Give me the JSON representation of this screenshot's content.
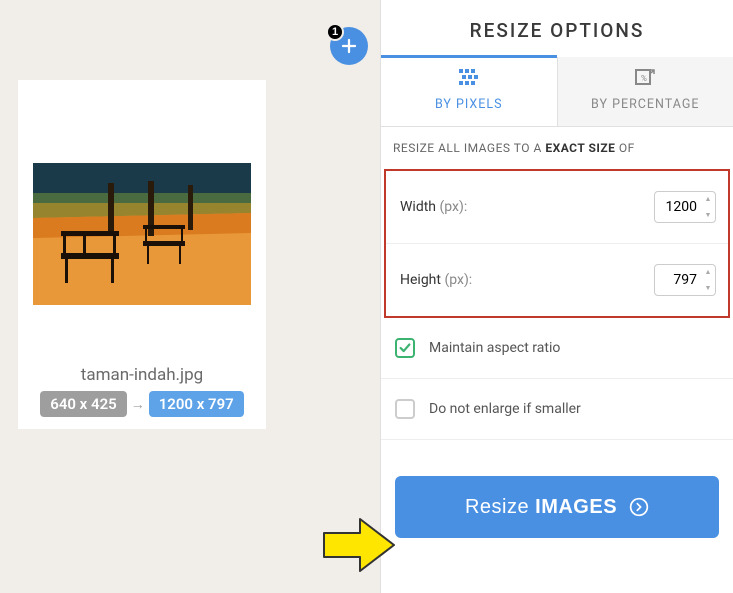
{
  "leftPanel": {
    "filename": "taman-indah.jpg",
    "original_size": "640 x 425",
    "target_size": "1200 x 797",
    "add_count": "1"
  },
  "rightPanel": {
    "title": "RESIZE OPTIONS",
    "tabs": {
      "pixels": "BY PIXELS",
      "percentage": "BY PERCENTAGE"
    },
    "subtitle_pre": "RESIZE ALL IMAGES TO A ",
    "subtitle_strong": "EXACT SIZE",
    "subtitle_post": " OF",
    "width_label": "Width",
    "height_label": "Height",
    "unit": " (px):",
    "width_value": "1200",
    "height_value": "797",
    "maintain_label": "Maintain aspect ratio",
    "enlarge_label": "Do not enlarge if smaller",
    "button_text1": "Resize ",
    "button_text2": "IMAGES"
  }
}
